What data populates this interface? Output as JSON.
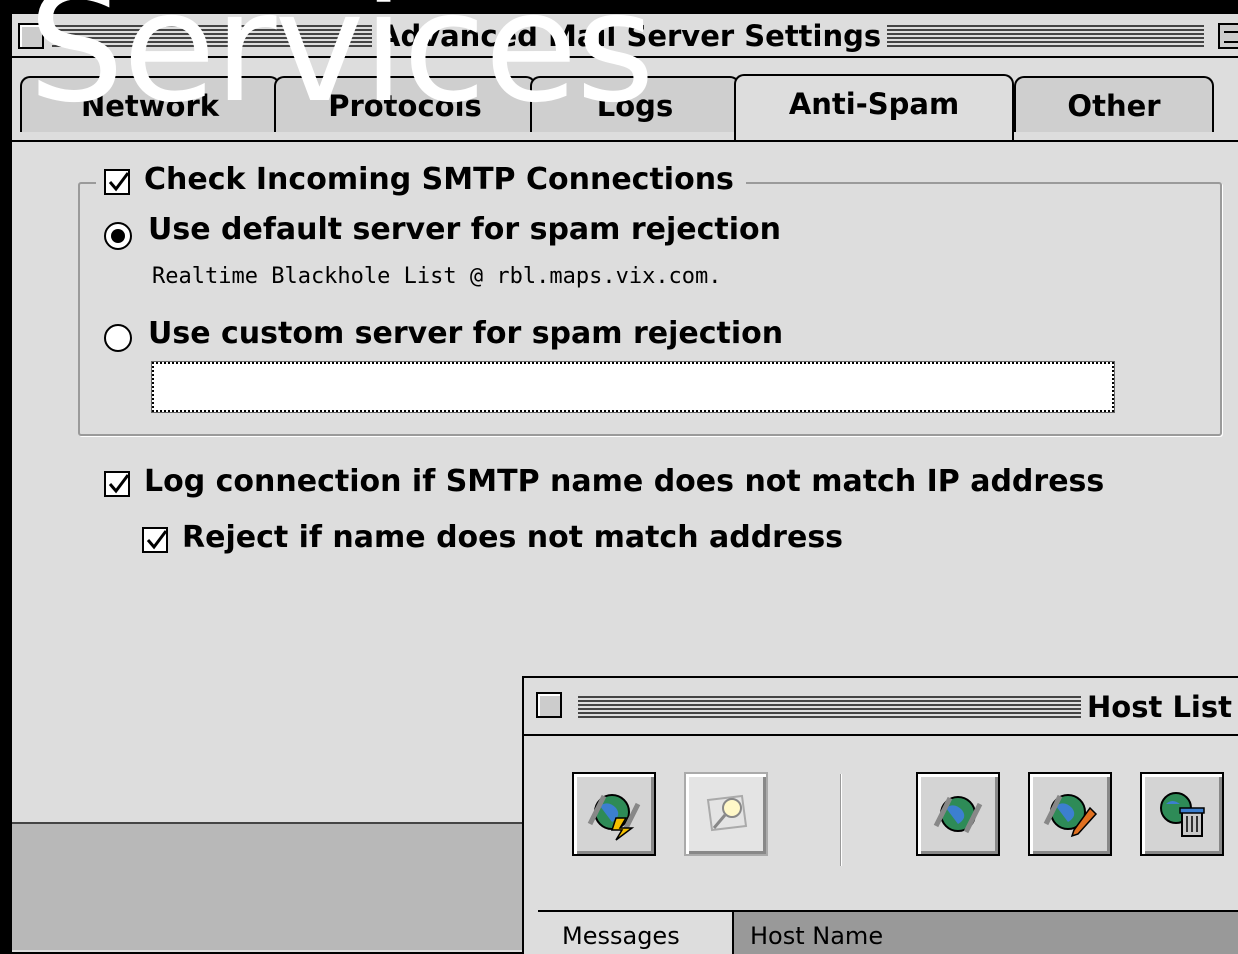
{
  "overlay_text": "Services",
  "window": {
    "title": "Advanced Mail Server Settings",
    "tabs": [
      {
        "label": "Network"
      },
      {
        "label": "Protocols"
      },
      {
        "label": "Logs"
      },
      {
        "label": "Anti-Spam",
        "active": true
      },
      {
        "label": "Other"
      }
    ]
  },
  "antispam": {
    "check_incoming_label": "Check Incoming SMTP Connections",
    "check_incoming_checked": true,
    "default_server_label": "Use default server for spam rejection",
    "default_server_selected": true,
    "rbl_info": "Realtime Blackhole List  @   rbl.maps.vix.com.",
    "custom_server_label": "Use custom server for  spam rejection",
    "custom_server_selected": false,
    "custom_server_value": "",
    "log_mismatch_label": "Log connection if SMTP name does not match IP address",
    "log_mismatch_checked": true,
    "reject_mismatch_label": "Reject if name does not match address",
    "reject_mismatch_checked": true
  },
  "host_list": {
    "title": "Host List",
    "toolbar": [
      {
        "icon": "globe-lightning-icon"
      },
      {
        "icon": "magnifier-icon",
        "disabled": true
      },
      {
        "icon": "globe-icon"
      },
      {
        "icon": "globe-pencil-icon"
      },
      {
        "icon": "globe-trash-icon"
      }
    ],
    "columns": [
      "Messages",
      "Host Name"
    ]
  }
}
